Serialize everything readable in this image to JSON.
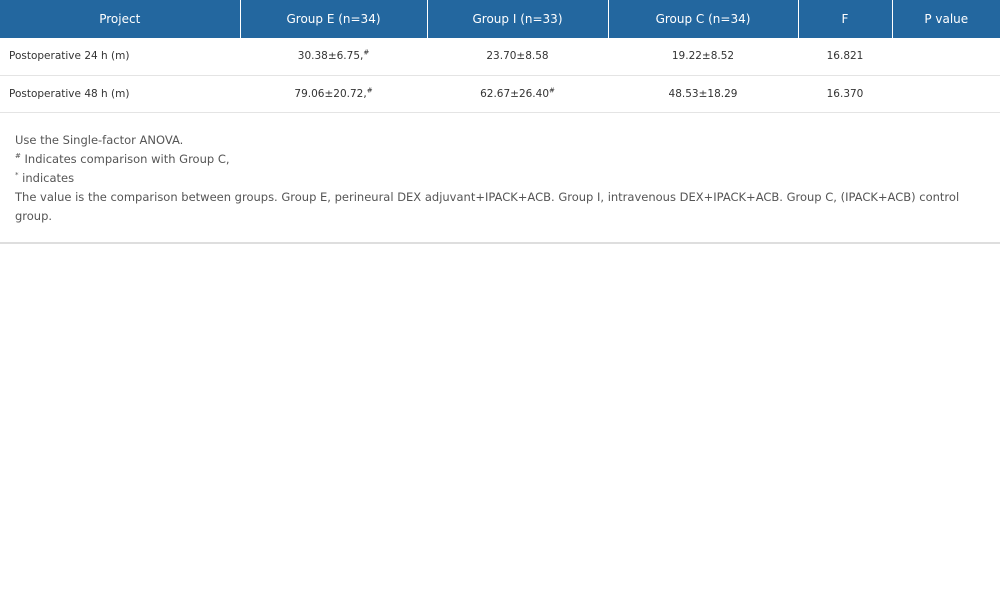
{
  "table": {
    "headers": [
      "Project",
      "Group E (n=34)",
      "Group I (n=33)",
      "Group C (n=34)",
      "F",
      "P value"
    ],
    "rows": [
      {
        "label": "Postoperative 24 h (m)",
        "group_e": "30.38±6.75,",
        "group_e_mark": "#",
        "group_i": "23.70±8.58",
        "group_i_mark": "",
        "group_c": "19.22±8.52",
        "f": "16.821",
        "p": ""
      },
      {
        "label": "Postoperative 48 h (m)",
        "group_e": "79.06±20.72,",
        "group_e_mark": "#",
        "group_i": "62.67±26.40",
        "group_i_mark": "#",
        "group_c": "48.53±18.29",
        "f": "16.370",
        "p": ""
      }
    ]
  },
  "footnotes": {
    "line1": "Use the Single-factor ANOVA.",
    "line2_mark": "#",
    "line2": " Indicates comparison with Group C,",
    "line3_mark": "*",
    "line3": " indicates",
    "line4": "The value is the comparison between groups. Group E, perineural DEX adjuvant+IPACK+ACB. Group I, intravenous DEX+IPACK+ACB. Group C, (IPACK+ACB) control group."
  },
  "colors": {
    "header_bg": "#23679f",
    "header_text": "#ffffff",
    "row_border": "#e4e4e4"
  }
}
